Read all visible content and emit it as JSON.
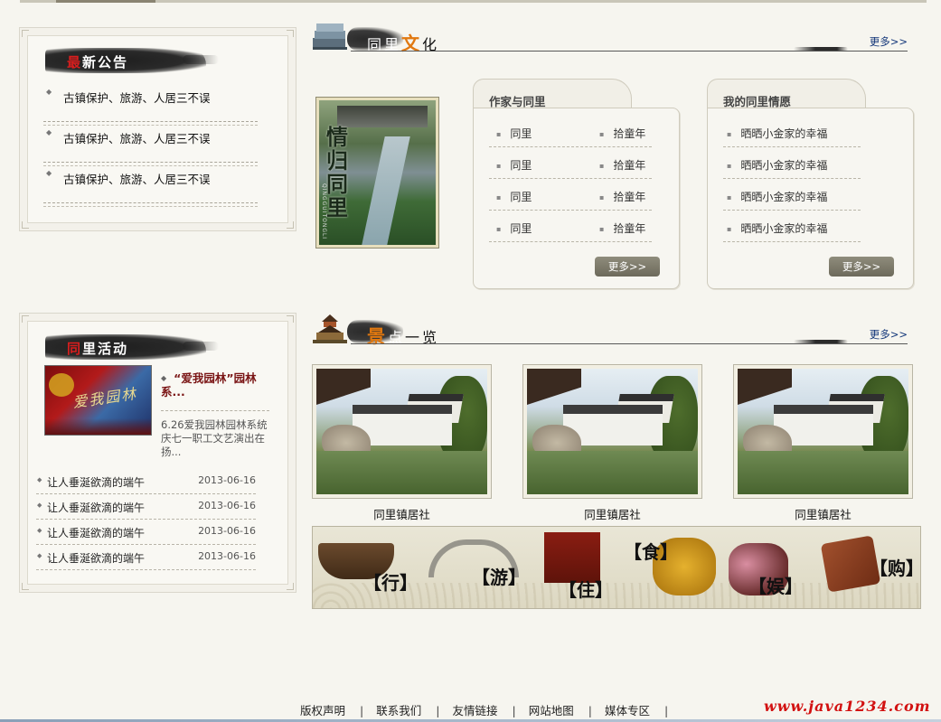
{
  "notice": {
    "title_first": "最",
    "title_rest": "新公告",
    "items": [
      "古镇保护、旅游、人居三不误",
      "古镇保护、旅游、人居三不误",
      "古镇保护、旅游、人居三不误"
    ]
  },
  "activity": {
    "title_first": "同",
    "title_rest": "里活动",
    "thumb_text": "爱我园林",
    "headline": "“爱我园林”园林系...",
    "summary": "6.26爱我园林园林系统庆七一职工文艺演出在扬...",
    "items": [
      {
        "title": "让人垂涎欲滴的端午",
        "date": "2013-06-16"
      },
      {
        "title": "让人垂涎欲滴的端午",
        "date": "2013-06-16"
      },
      {
        "title": "让人垂涎欲滴的端午",
        "date": "2013-06-16"
      },
      {
        "title": "让人垂涎欲滴的端午",
        "date": "2013-06-16"
      }
    ]
  },
  "culture": {
    "title_a": "同里",
    "title_b": "文",
    "title_c": "化",
    "more": "更多>>",
    "book_title": "情归同里",
    "book_pinyin": "QINGGUITONGLI",
    "card1": {
      "title": "作家与同里",
      "rows": [
        [
          "同里",
          "拾童年"
        ],
        [
          "同里",
          "拾童年"
        ],
        [
          "同里",
          "拾童年"
        ],
        [
          "同里",
          "拾童年"
        ]
      ],
      "button": "更多>>"
    },
    "card2": {
      "title": "我的同里情愿",
      "rows": [
        "晒晒小金家的幸福",
        "晒晒小金家的幸福",
        "晒晒小金家的幸福",
        "晒晒小金家的幸福"
      ],
      "button": "更多>>"
    }
  },
  "scenic": {
    "title_a": "景",
    "title_b": "点",
    "title_c": "一览",
    "more": "更多>>",
    "items": [
      "同里镇居社",
      "同里镇居社",
      "同里镇居社"
    ]
  },
  "banner": {
    "labels": [
      "【行】",
      "【游】",
      "【住】",
      "【食】",
      "【娱】",
      "【购】"
    ]
  },
  "footer": {
    "links": [
      "版权声明",
      "联系我们",
      "友情链接",
      "网站地图",
      "媒体专区"
    ],
    "separator": "|",
    "watermark": "www.java1234.com"
  },
  "colors": {
    "accent_red": "#d81e1e",
    "accent_orange": "#e1780f",
    "link_blue": "#14377a",
    "button_gray": "#7d7a6b"
  }
}
